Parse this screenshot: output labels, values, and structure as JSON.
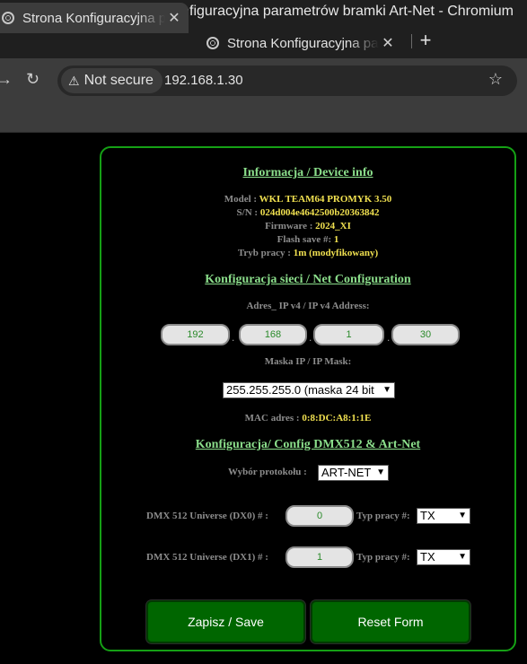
{
  "window": {
    "title": "Strona Konfiguracyjna parametrów bramki Art-Net - Chromium"
  },
  "tabs": [
    {
      "label": "Strona Konfiguracyjna parametrów bramki Art-Net"
    },
    {
      "label": "Strona Konfiguracyjna parametrów bramki Art-Net"
    }
  ],
  "toolbar": {
    "security": "Not secure",
    "url": "192.168.1.30"
  },
  "device_info": {
    "heading": "Informacja / Device info",
    "model_label": "Model :",
    "model_value": "WKL TEAM64 PROMYK 3.50",
    "sn_label": "S/N :",
    "sn_value": "024d004e4642500b20363842",
    "fw_label": "Firmware :",
    "fw_value": "2024_XI",
    "flash_label": "Flash save #:",
    "flash_value": "1",
    "mode_label": "Tryb pracy :",
    "mode_value": "1m (modyfikowany)"
  },
  "net": {
    "heading": "Konfiguracja sieci / Net Configuration",
    "ip_label": "Adres_ IP v4 / IP v4 Address:",
    "ip": [
      "192",
      "168",
      "1",
      "30"
    ],
    "mask_label": "Maska IP / IP Mask:",
    "mask_value": "255.255.255.0 (maska 24 bit",
    "mac_label": "MAC adres :",
    "mac_value": "0:8:DC:A8:1:1E"
  },
  "dmx": {
    "heading": "Konfiguracja/ Config DMX512 & Art-Net",
    "protocol_label": "Wybór protokołu :",
    "protocol_value": "ART-NET",
    "u0_label": "DMX 512 Universe (DX0) # :",
    "u0_value": "0",
    "u1_label": "DMX 512 Universe (DX1) # :",
    "u1_value": "1",
    "mode_label": "Typ pracy #:",
    "u0_mode": "TX",
    "u1_mode": "TX"
  },
  "buttons": {
    "save": "Zapisz / Save",
    "reset": "Reset Form"
  },
  "colors": {
    "accent": "#15a015",
    "value": "#f0e050",
    "button": "#006600"
  }
}
